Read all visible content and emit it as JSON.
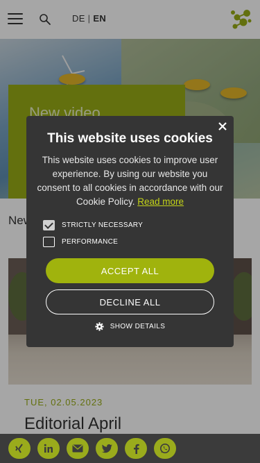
{
  "header": {
    "lang_de": "DE",
    "lang_sep": "|",
    "lang_en": "EN",
    "icons": [
      "menu-icon",
      "search-icon",
      "logo-icon"
    ]
  },
  "hero": {
    "video_text": "New video"
  },
  "content": {
    "section_label": "New",
    "news_date": "TUE, 02.05.2023",
    "news_title": "Editorial April"
  },
  "cookie_modal": {
    "title": "This website uses cookies",
    "body": "This website uses cookies to improve user experience. By using our website you consent to all cookies in accordance with our Cookie Policy.",
    "read_more": "Read more",
    "options": [
      {
        "label": "STRICTLY NECESSARY",
        "checked": true
      },
      {
        "label": "PERFORMANCE",
        "checked": false
      }
    ],
    "accept_label": "ACCEPT ALL",
    "decline_label": "DECLINE ALL",
    "show_details_label": "SHOW DETAILS"
  },
  "share_bar": {
    "buttons": [
      "xing-icon",
      "linkedin-icon",
      "email-icon",
      "twitter-icon",
      "facebook-icon",
      "whatsapp-icon"
    ]
  },
  "colors": {
    "brand_green": "#99ad16",
    "accept_green": "#a0b30d",
    "modal_bg": "#353535",
    "link_green": "#c4d418"
  }
}
